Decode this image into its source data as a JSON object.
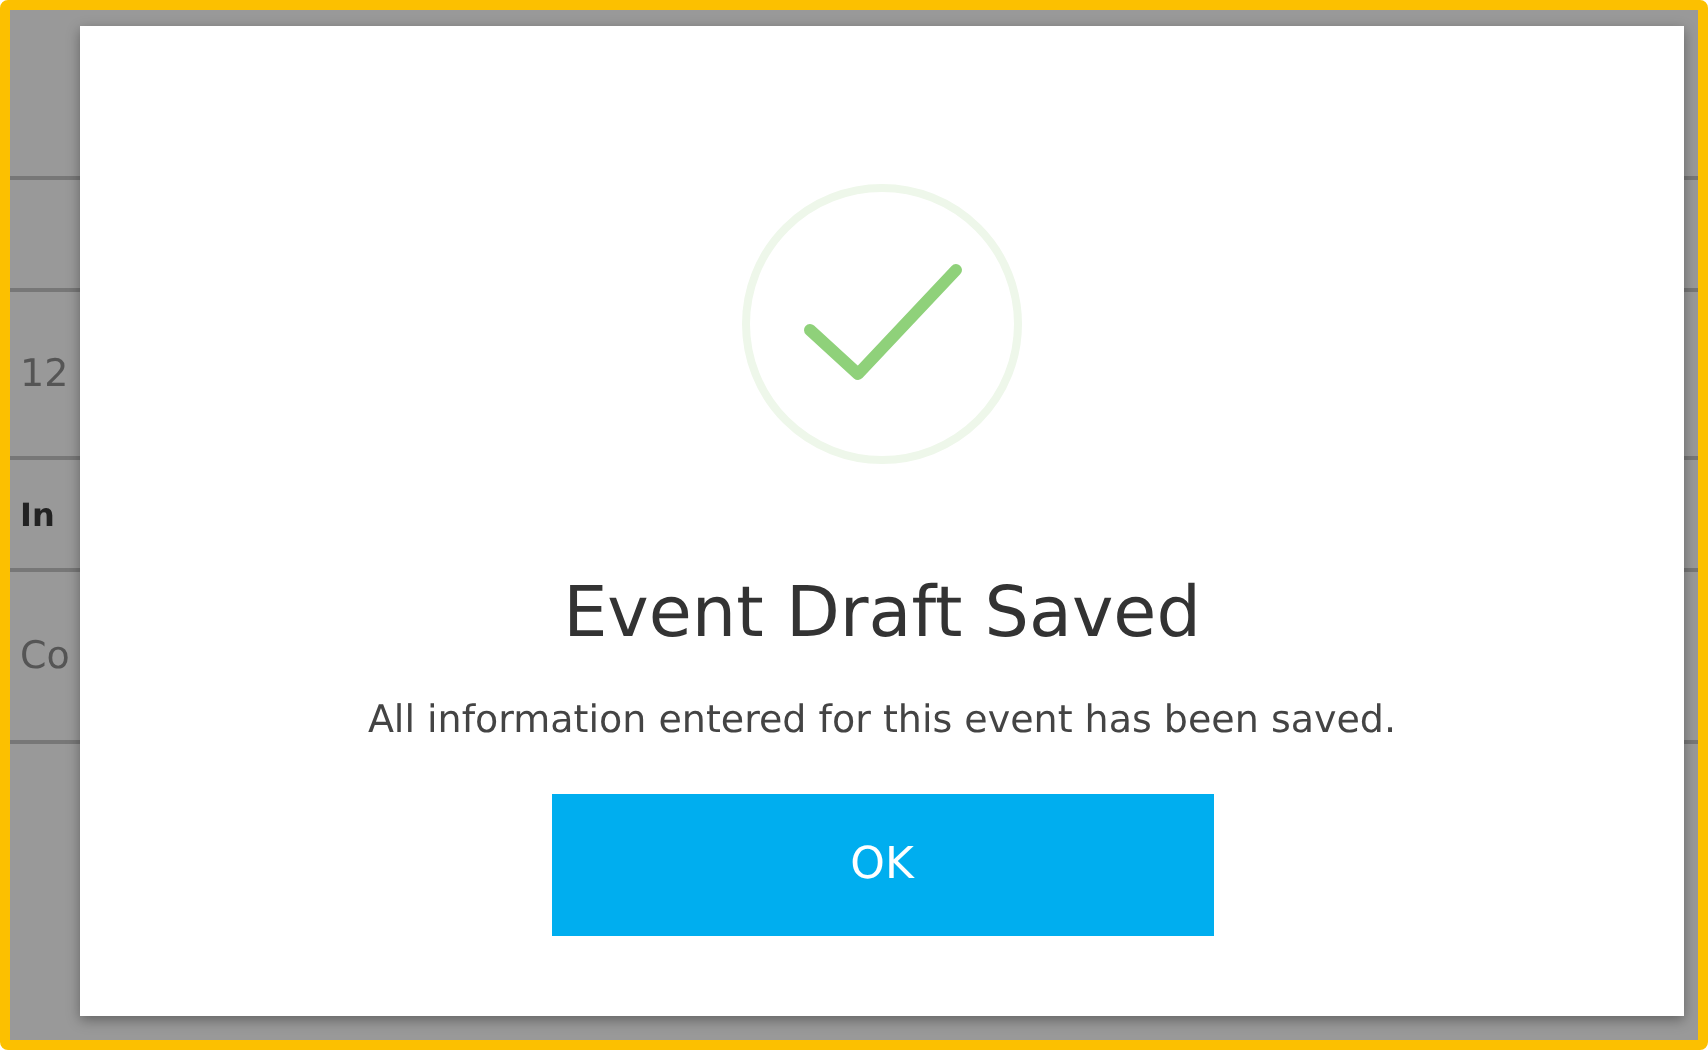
{
  "background": {
    "rows": [
      {
        "text": ""
      },
      {
        "text": ""
      },
      {
        "text": "12"
      },
      {
        "text": "In",
        "kind": "bold"
      },
      {
        "text": "Co"
      }
    ]
  },
  "dialog": {
    "title": "Event Draft Saved",
    "message": "All information entered for this event has been saved.",
    "button": "OK"
  }
}
